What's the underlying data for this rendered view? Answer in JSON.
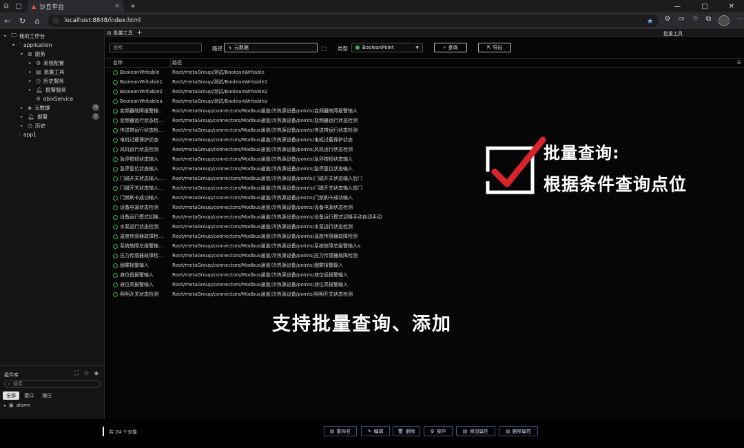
{
  "browser": {
    "tab_title": "沙丘平台",
    "tab_close": "×",
    "new_tab": "+",
    "url": "localhost:8848/index.html"
  },
  "sidebar": {
    "tree": [
      {
        "label": "我的工作台",
        "level": 0,
        "icon": "monitor-icon",
        "twisty": "▾"
      },
      {
        "label": "application",
        "level": 1,
        "icon": "app-icon",
        "twisty": "▾"
      },
      {
        "label": "服务",
        "level": 2,
        "icon": "database-icon",
        "twisty": "▾"
      },
      {
        "label": "系统配置",
        "level": 3,
        "icon": "settings-icon",
        "twisty": "▸"
      },
      {
        "label": "批量工具",
        "level": 3,
        "icon": "tool-icon",
        "twisty": "▸"
      },
      {
        "label": "历史服务",
        "level": 3,
        "icon": "history-icon",
        "twisty": "▸"
      },
      {
        "label": "报警服务",
        "level": 3,
        "icon": "bell-icon",
        "twisty": "▸"
      },
      {
        "label": "obixService",
        "level": 3,
        "icon": "gear-icon",
        "twisty": ""
      },
      {
        "label": "元数据",
        "level": 2,
        "icon": "cube-icon",
        "twisty": "▸",
        "badge": "71"
      },
      {
        "label": "报警",
        "level": 2,
        "icon": "bell-icon",
        "twisty": "▸",
        "badge": "2"
      },
      {
        "label": "历史",
        "level": 2,
        "icon": "history-icon",
        "twisty": "▸"
      },
      {
        "label": "app1",
        "level": 1,
        "icon": "app-icon",
        "twisty": ""
      }
    ],
    "library": {
      "title": "组件库",
      "search_placeholder": "搜索",
      "filters": [
        "全部",
        "接口",
        "插注"
      ],
      "items": [
        "alarm"
      ]
    }
  },
  "main": {
    "tab_label": "批量工具",
    "tab_add": "+",
    "right_panel_title": "批量工具",
    "toolbar": {
      "search_placeholder": "搜索",
      "path_label": "路径",
      "path_value": "元数据",
      "type_label": "类型",
      "type_value": "BooleanPoint",
      "query_button": "查询",
      "export_button": "导出"
    },
    "table": {
      "columns": [
        "名称",
        "路径"
      ],
      "rows": [
        {
          "name": "BooleanWritable",
          "path": "Root/metaGroup/测试/BooleanWritable"
        },
        {
          "name": "BooleanWritable1",
          "path": "Root/metaGroup/测试/BooleanWritable1"
        },
        {
          "name": "BooleanWritable2",
          "path": "Root/metaGroup/测试/BooleanWritable2"
        },
        {
          "name": "BooleanWritablea",
          "path": "Root/metaGroup/测试/BooleanWritablea"
        },
        {
          "name": "变频器故障报警输...",
          "path": "Root/metaGroup/connectors/Modbus通道/冷热源设备/points/变频器故障报警输入"
        },
        {
          "name": "变频器运行状态检...",
          "path": "Root/metaGroup/connectors/Modbus通道/冷热源设备/points/变频器运行状态检测"
        },
        {
          "name": "传送带运行状态检...",
          "path": "Root/metaGroup/connectors/Modbus通道/冷热源设备/points/传送带运行状态检测"
        },
        {
          "name": "电机过载保护状态",
          "path": "Root/metaGroup/connectors/Modbus通道/冷热源设备/points/电机过载保护状态"
        },
        {
          "name": "风机运行状态检测",
          "path": "Root/metaGroup/connectors/Modbus通道/冷热源设备/points/风机运行状态检测"
        },
        {
          "name": "急停按钮状态输入",
          "path": "Root/metaGroup/connectors/Modbus通道/冷热源设备/points/急停按钮状态输入"
        },
        {
          "name": "急停复位状态输入",
          "path": "Root/metaGroup/connectors/Modbus通道/冷热源设备/points/急停复位状态输入"
        },
        {
          "name": "门磁开关状态输入...",
          "path": "Root/metaGroup/connectors/Modbus通道/冷热源设备/points/门磁开关状态输入后门"
        },
        {
          "name": "门磁开关状态输入...",
          "path": "Root/metaGroup/connectors/Modbus通道/冷热源设备/points/门磁开关状态输入前门"
        },
        {
          "name": "门禁刷卡成功输入",
          "path": "Root/metaGroup/connectors/Modbus通道/冷热源设备/points/门禁刷卡成功输入"
        },
        {
          "name": "设备电源状态检测",
          "path": "Root/metaGroup/connectors/Modbus通道/冷热源设备/points/设备电源状态检测"
        },
        {
          "name": "设备运行模式切换...",
          "path": "Root/metaGroup/connectors/Modbus通道/冷热源设备/points/设备运行模式切换手动自动手动"
        },
        {
          "name": "水泵运行状态检测",
          "path": "Root/metaGroup/connectors/Modbus通道/冷热源设备/points/水泵运行状态检测"
        },
        {
          "name": "温度传感器故障检...",
          "path": "Root/metaGroup/connectors/Modbus通道/冷热源设备/points/温度传感器故障检测"
        },
        {
          "name": "系统故障总报警输...",
          "path": "Root/metaGroup/connectors/Modbus通道/冷热源设备/points/系统故障总报警输入a"
        },
        {
          "name": "压力传感器故障检...",
          "path": "Root/metaGroup/connectors/Modbus通道/冷热源设备/points/压力传感器故障检测"
        },
        {
          "name": "烟雾报警输入",
          "path": "Root/metaGroup/connectors/Modbus通道/冷热源设备/points/烟雾报警输入"
        },
        {
          "name": "液位低报警输入",
          "path": "Root/metaGroup/connectors/Modbus通道/冷热源设备/points/液位低报警输入"
        },
        {
          "name": "液位高报警输入",
          "path": "Root/metaGroup/connectors/Modbus通道/冷热源设备/points/液位高报警输入"
        },
        {
          "name": "照明开关状态检测",
          "path": "Root/metaGroup/connectors/Modbus通道/冷热源设备/points/照明开关状态检测"
        }
      ]
    },
    "count_text": "共 24 个对象",
    "actions": [
      {
        "label": "重命名",
        "icon": "rename-icon"
      },
      {
        "label": "编辑",
        "icon": "edit-icon"
      },
      {
        "label": "删除",
        "icon": "trash-icon"
      },
      {
        "label": "操作",
        "icon": "operate-icon"
      },
      {
        "label": "添加属性",
        "icon": "add-prop-icon"
      },
      {
        "label": "删除属性",
        "icon": "remove-prop-icon"
      }
    ]
  },
  "overlay": {
    "title": "批量查询:",
    "subtitle": "根据条件查询点位",
    "caption": "支持批量查询、添加"
  },
  "colors": {
    "accent_blue": "#3a5a9a",
    "status_green": "#3fb34f",
    "check_red": "#d9242a"
  }
}
